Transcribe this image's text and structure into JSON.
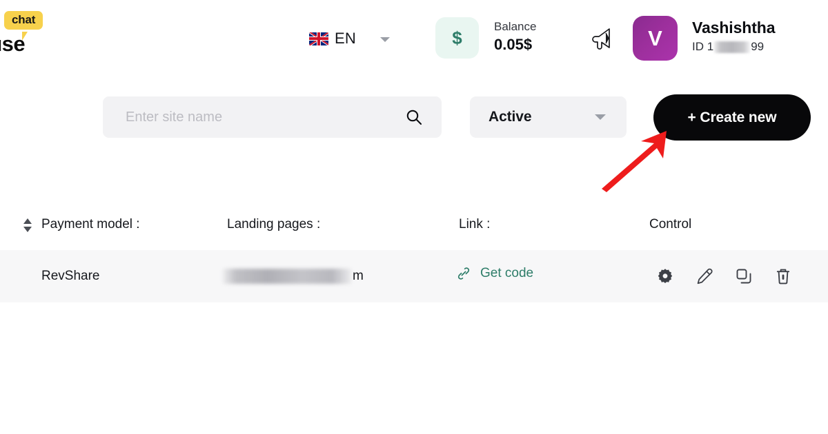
{
  "header": {
    "logo": {
      "bubble_text": "chat",
      "word_text": "ouse",
      "bubble_color": "#f7d14c"
    },
    "language": {
      "label": "EN",
      "flag_icon": "uk-flag-icon",
      "caret_icon": "chevron-down-icon"
    },
    "balance": {
      "currency_icon": "dollar-icon",
      "currency_symbol": "$",
      "label": "Balance",
      "value": "0.05$",
      "chip_bg": "#e9f6f1",
      "chip_fg": "#2e7d69"
    },
    "announcements_icon": "megaphone-icon",
    "user": {
      "avatar_initial": "V",
      "avatar_color": "#9c2f9c",
      "name": "Vashishtha",
      "id_prefix": "ID 1",
      "id_suffix": "99",
      "id_redacted": true
    }
  },
  "toolbar": {
    "search": {
      "placeholder": "Enter site name",
      "value": "",
      "icon": "search-icon"
    },
    "status_filter": {
      "selected": "Active",
      "options": [
        "Active"
      ],
      "caret_icon": "chevron-down-icon"
    },
    "create_button": {
      "label": "+ Create new",
      "bg": "#08080a",
      "fg": "#ffffff"
    },
    "annotation": {
      "type": "arrow",
      "color": "#ef1d1d",
      "points_to": "create_button"
    }
  },
  "table": {
    "sort_icon": "sort-arrows-icon",
    "columns": [
      {
        "key": "payment_model",
        "label": "Payment model :"
      },
      {
        "key": "landing_pages",
        "label": "Landing pages :"
      },
      {
        "key": "link",
        "label": "Link :"
      },
      {
        "key": "control",
        "label": "Control"
      }
    ],
    "rows": [
      {
        "payment_model": "RevShare",
        "landing_page_redacted": true,
        "landing_page_tail": "m",
        "link_label": "Get code",
        "link_icon": "chain-link-icon",
        "link_color": "#2e7d69",
        "controls": [
          {
            "name": "settings",
            "icon": "gear-icon"
          },
          {
            "name": "edit",
            "icon": "pencil-icon"
          },
          {
            "name": "duplicate",
            "icon": "copy-icon"
          },
          {
            "name": "delete",
            "icon": "trash-icon"
          }
        ]
      }
    ]
  }
}
